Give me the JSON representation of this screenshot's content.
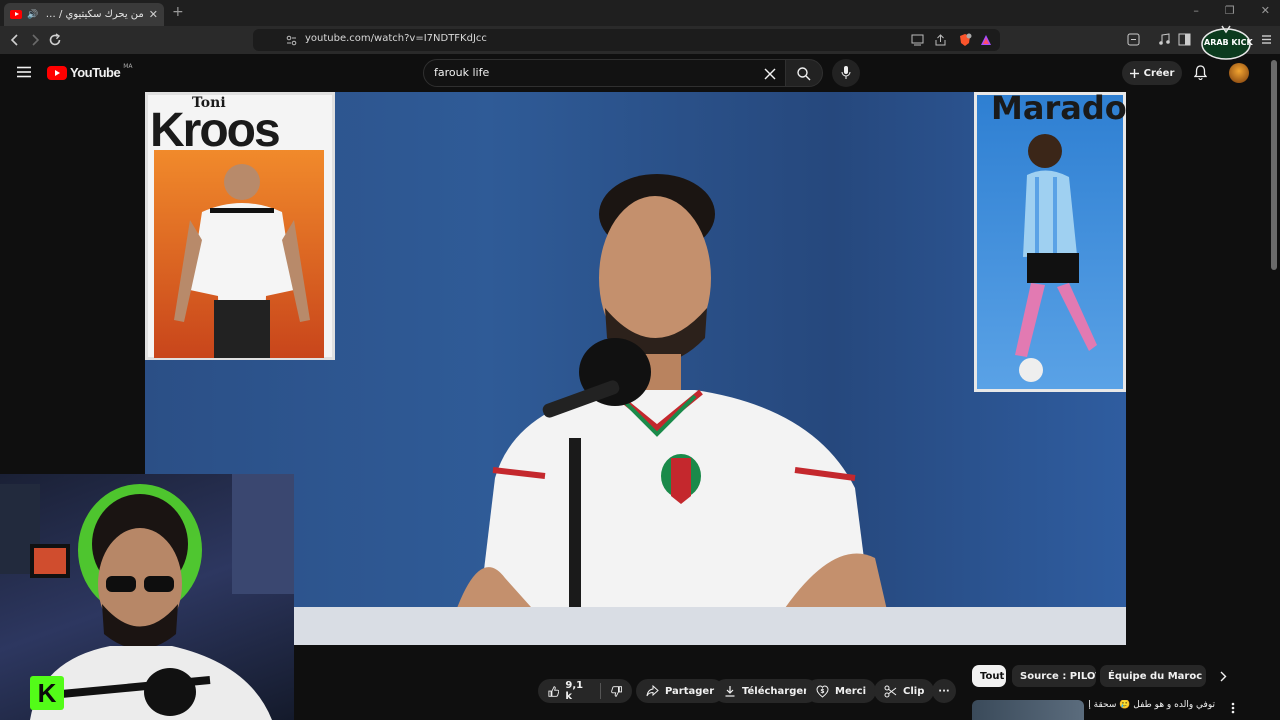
{
  "browser": {
    "tab_title": "من يحرك سكيتيوي / حريمات ؟",
    "new_tab_symbol": "+",
    "url": "youtube.com/watch?v=I7NDTFKdJcc"
  },
  "youtube": {
    "logo_text": "YouTube",
    "region": "MA",
    "search_value": "farouk life",
    "create_label": "Créer"
  },
  "video": {
    "poster_left_first": "Toni",
    "poster_left_last": "Kroos",
    "poster_right_name": "Maradona"
  },
  "actions": {
    "likes": "9,1 k",
    "share": "Partager",
    "download": "Télécharger",
    "thanks": "Merci",
    "clip": "Clip",
    "more": "···"
  },
  "chips": [
    {
      "label": "Tout"
    },
    {
      "label": "Source : PILOTA"
    },
    {
      "label": "Équipe du Maroc de football"
    }
  ],
  "recommendation": {
    "title": "توفي والده و هو طفل 🥲 سحقة إلتقى شخص"
  },
  "overlay": {
    "kick_letter": "K",
    "badge_text": "ARAB KICK"
  },
  "colors": {
    "youtube_red": "#ff0000",
    "kick_green": "#53fc18"
  }
}
